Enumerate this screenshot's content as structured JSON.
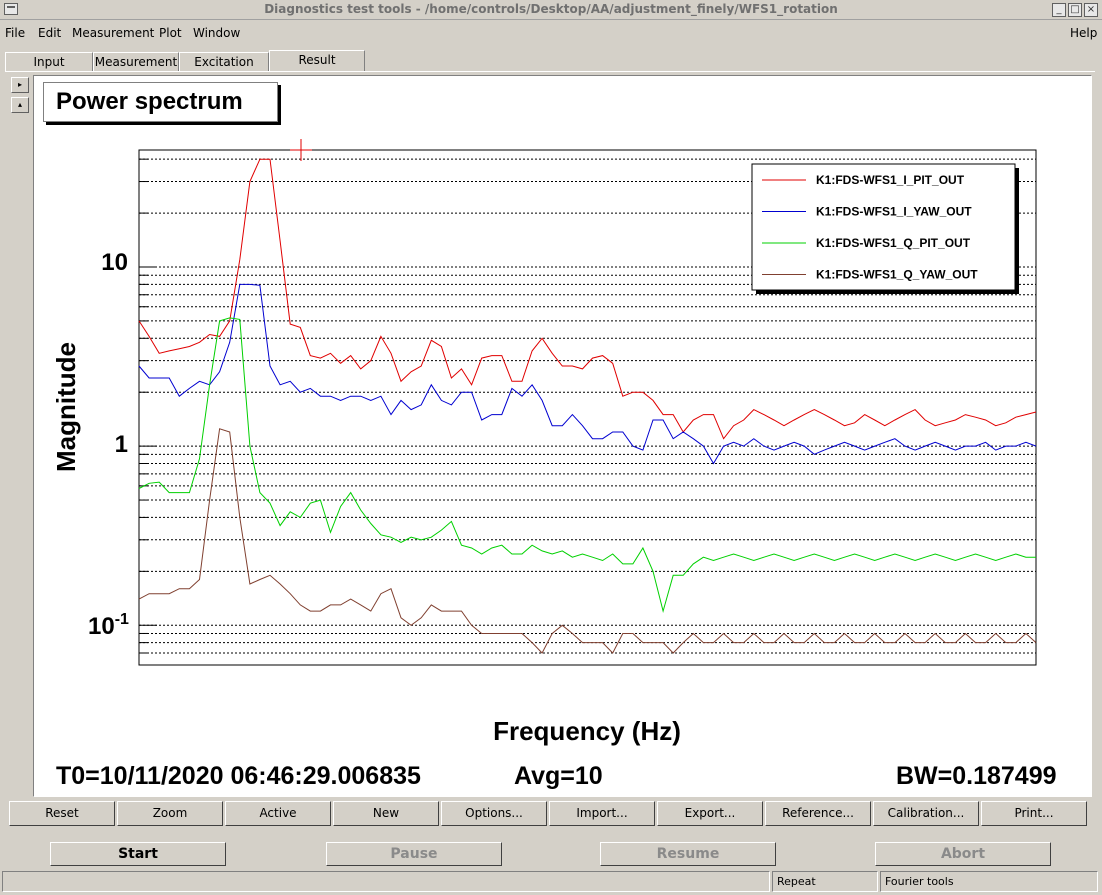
{
  "window": {
    "title": "Diagnostics test tools - /home/controls/Desktop/AA/adjustment_finely/WFS1_rotation",
    "controls": [
      "_",
      "□",
      "×"
    ]
  },
  "menu": {
    "left": [
      "File",
      "Edit",
      "Measurement",
      "Plot",
      "Window"
    ],
    "right": "Help"
  },
  "tabs": [
    "Input",
    "Measurement",
    "Excitation",
    "Result"
  ],
  "active_tab": "Result",
  "side_buttons": [
    "▸",
    "▴"
  ],
  "plot": {
    "title": "Power spectrum",
    "xlabel": "Frequency (Hz)",
    "ylabel": "Magnitude",
    "ytick_labels": [
      "10",
      "1"
    ],
    "ytick_base": "10",
    "ytick_exp": "-1"
  },
  "chart_data": {
    "type": "line",
    "title": "Power spectrum",
    "xlabel": "Frequency (Hz)",
    "ylabel": "Magnitude",
    "yscale": "log",
    "ylim": [
      0.06,
      45
    ],
    "grid": "horizontal",
    "legend_position": "top-right",
    "x": [
      0,
      1,
      2,
      3,
      4,
      5,
      6,
      7,
      8,
      9,
      10,
      11,
      12,
      13,
      14,
      15,
      16,
      17,
      18,
      19,
      20,
      21,
      22,
      23,
      24,
      25,
      26,
      27,
      28,
      29,
      30,
      31,
      32,
      33,
      34,
      35,
      36,
      37,
      38,
      39,
      40,
      41,
      42,
      43,
      44,
      45,
      46,
      47,
      48,
      49,
      50,
      51,
      52,
      53,
      54,
      55,
      56,
      57,
      58,
      59,
      60,
      61,
      62,
      63,
      64,
      65,
      66,
      67,
      68,
      69,
      70,
      71,
      72,
      73,
      74,
      75,
      76,
      77,
      78,
      79,
      80,
      81,
      82,
      83,
      84,
      85,
      86,
      87,
      88,
      89
    ],
    "series": [
      {
        "name": "K1:FDS-WFS1_I_PIT_OUT",
        "color": "#e00000",
        "values": [
          5.0,
          4.1,
          3.3,
          3.4,
          3.5,
          3.6,
          3.8,
          4.2,
          4.1,
          5.0,
          11,
          30,
          40,
          40,
          14,
          4.8,
          4.6,
          3.2,
          3.1,
          3.3,
          2.9,
          3.2,
          2.7,
          3.0,
          4.1,
          3.3,
          2.3,
          2.6,
          2.8,
          3.9,
          3.6,
          2.4,
          2.7,
          2.2,
          3.1,
          3.2,
          3.2,
          2.3,
          2.3,
          3.4,
          4.0,
          3.3,
          2.8,
          2.8,
          2.7,
          3.1,
          3.2,
          2.9,
          1.9,
          2.0,
          2.0,
          1.8,
          1.5,
          1.5,
          1.2,
          1.4,
          1.5,
          1.5,
          1.1,
          1.3,
          1.4,
          1.6,
          1.5,
          1.4,
          1.3,
          1.4,
          1.5,
          1.6,
          1.5,
          1.4,
          1.3,
          1.35,
          1.5,
          1.4,
          1.3,
          1.4,
          1.5,
          1.6,
          1.4,
          1.3,
          1.35,
          1.4,
          1.5,
          1.45,
          1.4,
          1.3,
          1.35,
          1.45,
          1.5,
          1.55
        ]
      },
      {
        "name": "K1:FDS-WFS1_I_YAW_OUT",
        "color": "#0000d0",
        "values": [
          2.8,
          2.4,
          2.4,
          2.4,
          1.9,
          2.1,
          2.3,
          2.2,
          2.6,
          3.8,
          8.0,
          8.0,
          7.9,
          2.8,
          2.2,
          2.3,
          2.0,
          2.1,
          1.9,
          1.9,
          1.8,
          1.9,
          1.9,
          1.8,
          1.9,
          1.5,
          1.8,
          1.6,
          1.7,
          2.2,
          1.8,
          1.7,
          2.0,
          2.0,
          1.4,
          1.5,
          1.5,
          2.1,
          1.9,
          2.2,
          1.8,
          1.3,
          1.3,
          1.5,
          1.3,
          1.1,
          1.1,
          1.2,
          1.2,
          1.0,
          0.95,
          1.4,
          1.4,
          1.1,
          1.2,
          1.1,
          1.0,
          0.8,
          1.0,
          1.05,
          1.0,
          1.1,
          1.0,
          0.95,
          1.0,
          1.05,
          1.0,
          0.9,
          0.95,
          1.0,
          1.05,
          1.0,
          0.95,
          1.0,
          1.05,
          1.1,
          1.0,
          0.95,
          1.0,
          1.05,
          1.0,
          0.95,
          1.0,
          1.0,
          1.05,
          0.95,
          1.0,
          1.0,
          1.05,
          1.0
        ]
      },
      {
        "name": "K1:FDS-WFS1_Q_PIT_OUT",
        "color": "#00d000",
        "values": [
          0.58,
          0.62,
          0.63,
          0.55,
          0.55,
          0.55,
          0.85,
          2.2,
          5.0,
          5.2,
          5.1,
          1.0,
          0.55,
          0.48,
          0.36,
          0.43,
          0.4,
          0.48,
          0.5,
          0.33,
          0.46,
          0.55,
          0.44,
          0.37,
          0.32,
          0.31,
          0.29,
          0.31,
          0.3,
          0.31,
          0.34,
          0.38,
          0.28,
          0.27,
          0.25,
          0.27,
          0.28,
          0.25,
          0.25,
          0.28,
          0.26,
          0.25,
          0.26,
          0.24,
          0.25,
          0.24,
          0.23,
          0.25,
          0.22,
          0.22,
          0.27,
          0.2,
          0.12,
          0.19,
          0.19,
          0.22,
          0.24,
          0.23,
          0.24,
          0.25,
          0.24,
          0.23,
          0.24,
          0.25,
          0.24,
          0.23,
          0.24,
          0.25,
          0.24,
          0.23,
          0.24,
          0.25,
          0.24,
          0.23,
          0.24,
          0.25,
          0.24,
          0.23,
          0.24,
          0.25,
          0.24,
          0.23,
          0.24,
          0.25,
          0.24,
          0.23,
          0.24,
          0.25,
          0.24,
          0.24
        ]
      },
      {
        "name": "K1:FDS-WFS1_Q_YAW_OUT",
        "color": "#804030",
        "values": [
          0.14,
          0.15,
          0.15,
          0.15,
          0.16,
          0.16,
          0.18,
          0.5,
          1.25,
          1.2,
          0.4,
          0.17,
          0.18,
          0.19,
          0.17,
          0.15,
          0.13,
          0.12,
          0.12,
          0.13,
          0.13,
          0.14,
          0.13,
          0.12,
          0.15,
          0.16,
          0.11,
          0.1,
          0.11,
          0.13,
          0.12,
          0.12,
          0.12,
          0.1,
          0.09,
          0.09,
          0.09,
          0.09,
          0.09,
          0.08,
          0.07,
          0.09,
          0.1,
          0.09,
          0.08,
          0.08,
          0.08,
          0.07,
          0.09,
          0.09,
          0.08,
          0.08,
          0.08,
          0.07,
          0.08,
          0.09,
          0.08,
          0.08,
          0.09,
          0.08,
          0.08,
          0.09,
          0.08,
          0.08,
          0.09,
          0.08,
          0.08,
          0.09,
          0.08,
          0.08,
          0.09,
          0.08,
          0.08,
          0.09,
          0.08,
          0.08,
          0.09,
          0.08,
          0.08,
          0.09,
          0.08,
          0.08,
          0.09,
          0.08,
          0.08,
          0.09,
          0.08,
          0.08,
          0.09,
          0.08
        ]
      }
    ]
  },
  "info": {
    "t0": "T0=10/11/2020 06:46:29.006835",
    "avg": "Avg=10",
    "bw": "BW=0.187499"
  },
  "buttons_row1": [
    "Reset",
    "Zoom",
    "Active",
    "New",
    "Options...",
    "Import...",
    "Export...",
    "Reference...",
    "Calibration...",
    "Print..."
  ],
  "buttons_row2": {
    "start": "Start",
    "pause": "Pause",
    "resume": "Resume",
    "abort": "Abort"
  },
  "status": {
    "mode": "Repeat",
    "app": "Fourier tools"
  }
}
